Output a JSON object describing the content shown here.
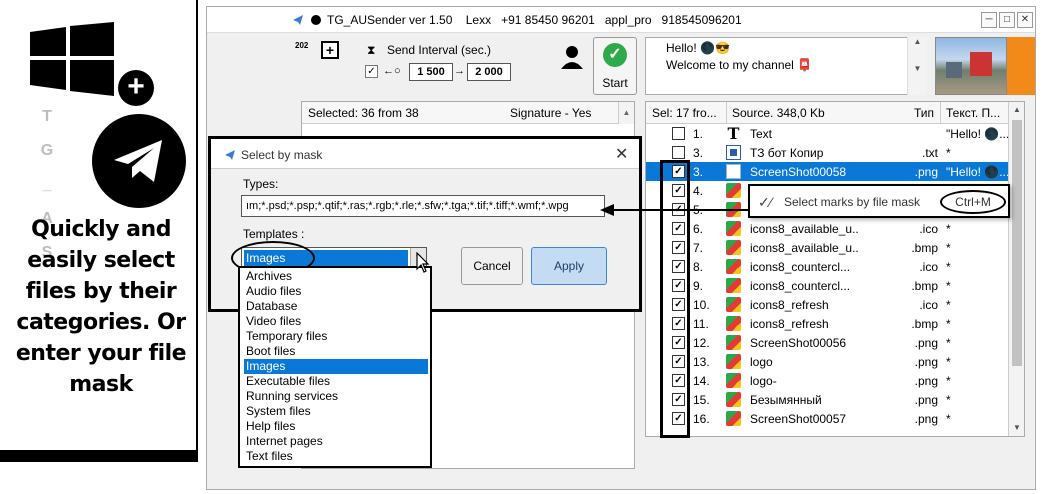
{
  "promo": {
    "text": "Quickly and easily select files by their categories. Or enter your file mask",
    "side_letters": [
      "T",
      "G",
      "_",
      "A",
      "S"
    ]
  },
  "main_window": {
    "title": "TG_AUSender ver 1.50    Lexx   +91 85450 96201   appl_pro   918545096201",
    "counter": "202",
    "send_interval_label": "Send Interval (sec.)",
    "interval_from": "1 500",
    "interval_to": "2 000",
    "start_label": "Start",
    "message_line1": "Hello! 🌑😎",
    "message_line2": "Welcome to my channel 📮",
    "left_list": {
      "col_selected": "Selected: 36 from 38",
      "col_signature": "Signature - Yes"
    },
    "right_list": {
      "col_sel": "Sel:",
      "col_count": "17 fro...",
      "col_source": "Source. 348,0 Kb",
      "col_type": "Тип",
      "col_text": "Текст. П...",
      "rows": [
        {
          "checked": false,
          "num": "1.",
          "icon": "text-icon",
          "name": "Text",
          "ext": "",
          "txt": "\"Hello! 🌑..."
        },
        {
          "checked": false,
          "num": "3.",
          "icon": "doc-icon",
          "name": "ТЗ бот Копир",
          "ext": ".txt",
          "txt": "*"
        },
        {
          "checked": true,
          "num": "3.",
          "icon": "image-icon",
          "name": "ScreenShot00058",
          "ext": ".png",
          "txt": "\"Hello! 🌑...",
          "selected": true
        },
        {
          "checked": true,
          "num": "4.",
          "icon": "image-icon",
          "name": "",
          "ext": "",
          "txt": ""
        },
        {
          "checked": true,
          "num": "5.",
          "icon": "image-icon",
          "name": "",
          "ext": "",
          "txt": ""
        },
        {
          "checked": true,
          "num": "6.",
          "icon": "image-icon",
          "name": "icons8_available_u...",
          "ext": ".ico",
          "txt": "*"
        },
        {
          "checked": true,
          "num": "7.",
          "icon": "image-icon",
          "name": "icons8_available_u...",
          "ext": ".bmp",
          "txt": "*"
        },
        {
          "checked": true,
          "num": "8.",
          "icon": "image-icon",
          "name": "icons8_countercl...",
          "ext": ".ico",
          "txt": "*"
        },
        {
          "checked": true,
          "num": "9.",
          "icon": "image-icon",
          "name": "icons8_countercl...",
          "ext": ".bmp",
          "txt": "*"
        },
        {
          "checked": true,
          "num": "10.",
          "icon": "image-icon",
          "name": "icons8_refresh",
          "ext": ".ico",
          "txt": "*"
        },
        {
          "checked": true,
          "num": "11.",
          "icon": "image-icon",
          "name": "icons8_refresh",
          "ext": ".bmp",
          "txt": "*"
        },
        {
          "checked": true,
          "num": "12.",
          "icon": "image-icon",
          "name": "ScreenShot00056",
          "ext": ".png",
          "txt": "*"
        },
        {
          "checked": true,
          "num": "13.",
          "icon": "image-icon",
          "name": "logo",
          "ext": ".png",
          "txt": "*"
        },
        {
          "checked": true,
          "num": "14.",
          "icon": "image-icon",
          "name": "logo-",
          "ext": ".png",
          "txt": "*"
        },
        {
          "checked": true,
          "num": "15.",
          "icon": "image-icon",
          "name": "Безымянный",
          "ext": ".png",
          "txt": "*"
        },
        {
          "checked": true,
          "num": "16.",
          "icon": "image-icon",
          "name": "ScreenShot00057",
          "ext": ".png",
          "txt": "*"
        }
      ]
    },
    "context_menu": {
      "label": "Select marks by file mask",
      "shortcut": "Ctrl+M"
    }
  },
  "dialog": {
    "title": "Select by mask",
    "types_label": "Types:",
    "types_value": "ım;*.psd;*.psp;*.qtif;*.ras;*.rgb;*.rle;*.sfw;*.tga;*.tif;*.tiff;*.wmf;*.wpg",
    "templates_label": "Templates :",
    "template_selected": "Images",
    "cancel_label": "Cancel",
    "apply_label": "Apply",
    "options": [
      "Archives",
      "Audio files",
      "Database",
      "Video files",
      "Temporary files",
      "Boot files",
      "Images",
      "Executable files",
      "Running services",
      "System files",
      "Help files",
      "Internet pages",
      "Text files"
    ]
  },
  "colors": {
    "selection": "#0a78d7",
    "start_green": "#2eaa4a",
    "accent_orange": "#f28a1a"
  }
}
